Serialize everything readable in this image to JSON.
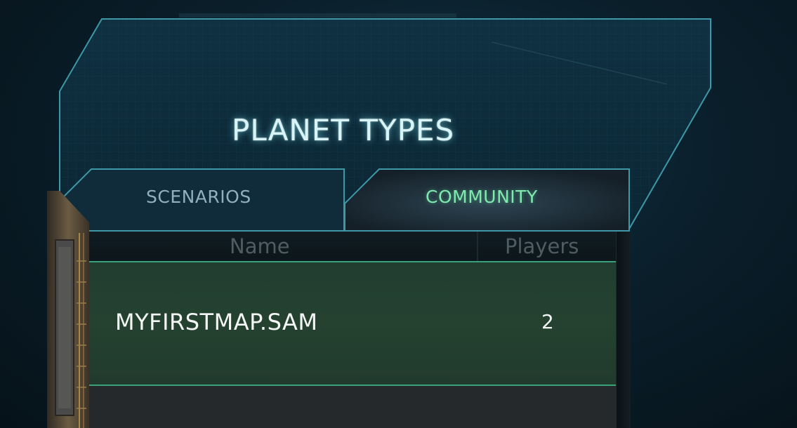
{
  "title": "PLANET TYPES",
  "tabs": [
    {
      "label": "SCENARIOS",
      "selected": false
    },
    {
      "label": "COMMUNITY",
      "selected": true
    }
  ],
  "table": {
    "columns": [
      "Name",
      "Players"
    ],
    "rows": [
      {
        "name": "MYFIRSTMAP.SAM",
        "players": "2"
      }
    ]
  },
  "colors": {
    "accent": "#7fe9ae",
    "frame": "#3e98a8",
    "row_border": "#3aa27a"
  }
}
